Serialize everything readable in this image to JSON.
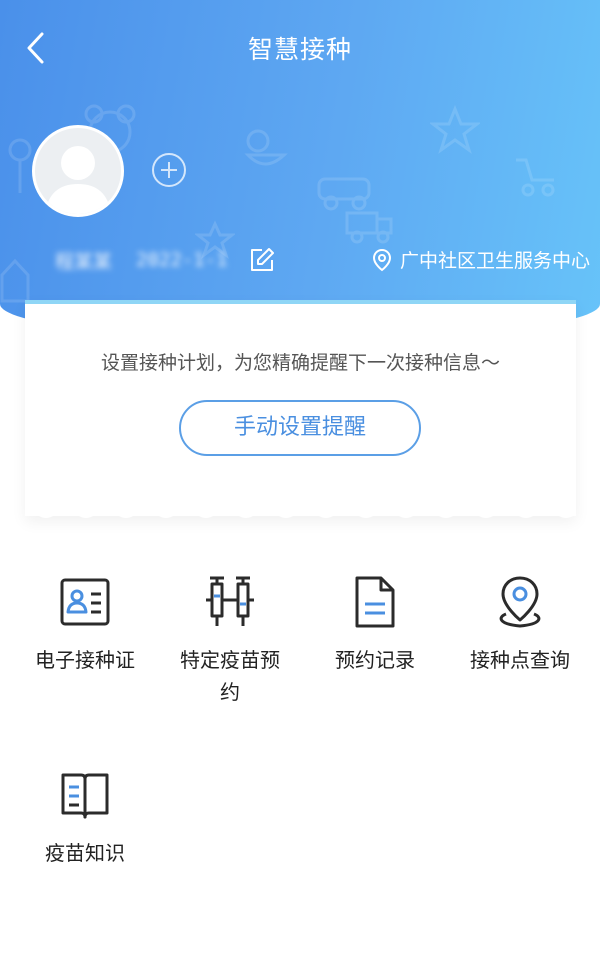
{
  "header": {
    "title": "智慧接种",
    "child_name": "程某某",
    "child_birthdate": "2022-1-1",
    "clinic_name": "广中社区卫生服务中心"
  },
  "reminder": {
    "message": "设置接种计划，为您精确提醒下一次接种信息～",
    "button_label": "手动设置提醒"
  },
  "menu": {
    "items": [
      {
        "label": "电子接种证",
        "icon": "id-card-icon"
      },
      {
        "label": "特定疫苗预约",
        "icon": "syringe-icon"
      },
      {
        "label": "预约记录",
        "icon": "document-icon"
      },
      {
        "label": "接种点查询",
        "icon": "location-pin-icon"
      },
      {
        "label": "疫苗知识",
        "icon": "book-icon"
      }
    ]
  },
  "colors": {
    "header_gradient_start": "#4a90ea",
    "header_gradient_end": "#67c3f9",
    "accent_blue": "#4a8fe0",
    "icon_dark": "#2b2b2b"
  }
}
